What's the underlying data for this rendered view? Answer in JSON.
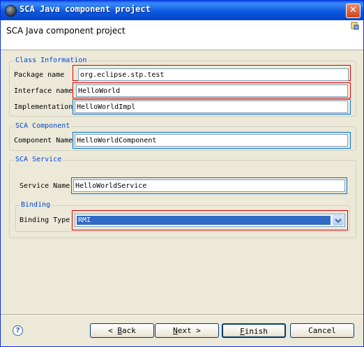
{
  "window": {
    "title": "SCA Java component project",
    "close_symbol": "✕"
  },
  "header": {
    "title": "SCA Java component project"
  },
  "class_info": {
    "legend": "Class Information",
    "package_label": "Package name",
    "package_value": "org.eclipse.stp.test",
    "interface_label": "Interface name",
    "interface_value": "HelloWorld",
    "impl_label": "Implementation",
    "impl_value": "HelloWorldImpl"
  },
  "sca_component": {
    "legend": "SCA Component",
    "name_label": "Component Name",
    "name_value": "HelloWorldComponent"
  },
  "sca_service": {
    "legend": "SCA Service",
    "name_label": "Service Name",
    "name_value": "HelloWorldService"
  },
  "binding": {
    "legend": "Binding",
    "type_label": "Binding Type",
    "type_value": "RMI"
  },
  "buttons": {
    "back_prefix": "< ",
    "back_mnemonic": "B",
    "back_rest": "ack",
    "next_mnemonic": "N",
    "next_rest": "ext >",
    "finish_mnemonic": "F",
    "finish_rest": "inish",
    "cancel": "Cancel"
  },
  "help_symbol": "?",
  "icons": {
    "title": "eclipse-icon",
    "header": "wizard-icon",
    "help": "help-icon",
    "dropdown": "chevron-down-icon"
  }
}
